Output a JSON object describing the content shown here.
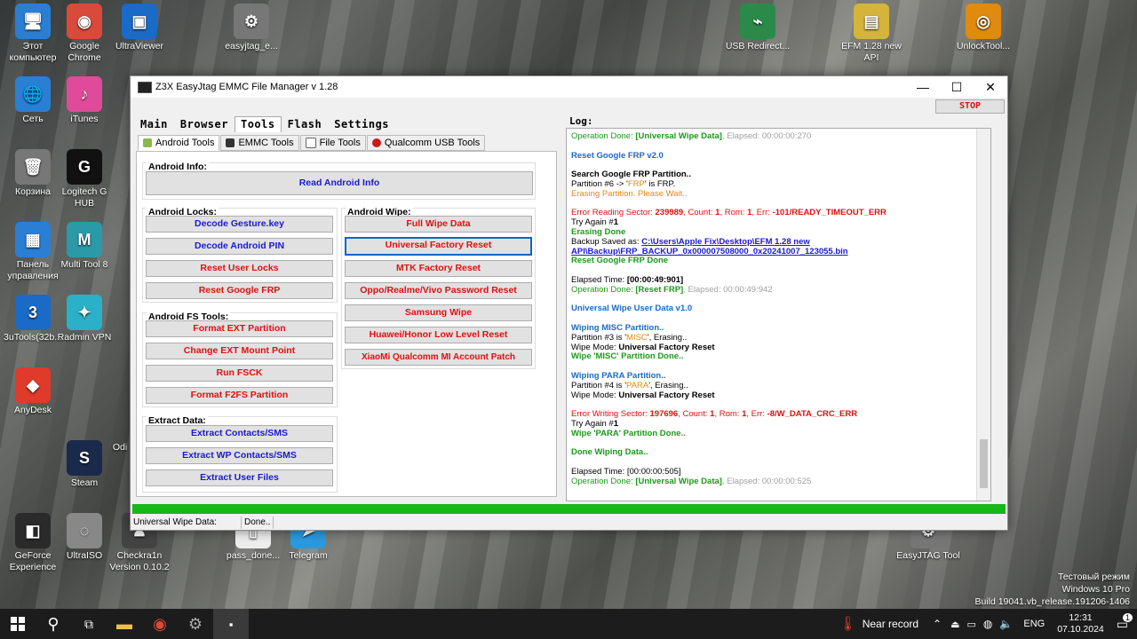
{
  "desktop": {
    "icons": [
      {
        "label": "Этот компьютер",
        "glyph": "🖥",
        "color": "#2a7fd4"
      },
      {
        "label": "Google Chrome",
        "glyph": "◉",
        "color": "#d94a3a"
      },
      {
        "label": "UltraViewer",
        "glyph": "▣",
        "color": "#1a6ac8"
      },
      {
        "label": "easyjtag_e...",
        "glyph": "⚙",
        "color": "#777"
      },
      {
        "label": "USB Redirect...",
        "glyph": "⌁",
        "color": "#2a8a4a"
      },
      {
        "label": "EFM 1.28 new API",
        "glyph": "▤",
        "color": "#d4b43a"
      },
      {
        "label": "UnlockTool...",
        "glyph": "◎",
        "color": "#e08a10"
      },
      {
        "label": "Сеть",
        "glyph": "🌐",
        "color": "#2a7fd4"
      },
      {
        "label": "iTunes",
        "glyph": "♪",
        "color": "#e04a9a"
      },
      {
        "label": "Корзина",
        "glyph": "🗑",
        "color": "#777"
      },
      {
        "label": "Logitech G HUB",
        "glyph": "G",
        "color": "#111"
      },
      {
        "label": "Панель управления",
        "glyph": "▦",
        "color": "#2a7fd4"
      },
      {
        "label": "Multi Tool 8",
        "glyph": "M",
        "color": "#2a9aa8"
      },
      {
        "label": "3uTools(32b...",
        "glyph": "3",
        "color": "#1a6ac8"
      },
      {
        "label": "Radmin VPN",
        "glyph": "✦",
        "color": "#2ab0c8"
      },
      {
        "label": "AnyDesk",
        "glyph": "◆",
        "color": "#e03a2a"
      },
      {
        "label": "Odi",
        "glyph": "",
        "color": "transparent"
      },
      {
        "label": "Steam",
        "glyph": "S",
        "color": "#1a2a4a"
      },
      {
        "label": "GeForce Experience",
        "glyph": "◧",
        "color": "#2a2a2a"
      },
      {
        "label": "UltraISO",
        "glyph": "◌",
        "color": "#888"
      },
      {
        "label": "Checkra1n Version 0.10.2",
        "glyph": "♟",
        "color": "#444"
      },
      {
        "label": "pass_done...",
        "glyph": "▯",
        "color": "#eee"
      },
      {
        "label": "Telegram",
        "glyph": "➤",
        "color": "#2a9ae0"
      },
      {
        "label": "EasyJTAG Tool",
        "glyph": "⚙",
        "color": "#777"
      }
    ]
  },
  "window": {
    "title": "Z3X EasyJtag EMMC File Manager v 1.28",
    "min": "—",
    "max": "☐",
    "close": "✕",
    "stop": "STOP",
    "main_tabs": [
      "Main",
      "Browser",
      "Tools",
      "Flash",
      "Settings"
    ],
    "sub_tabs": [
      "Android Tools",
      "EMMC Tools",
      "File Tools",
      "Qualcomm USB Tools"
    ],
    "android_info": {
      "label": "Android Info:",
      "btn": "Read Android Info"
    },
    "android_locks": {
      "label": "Android Locks:",
      "btns": [
        "Decode Gesture.key",
        "Decode Android PIN",
        "Reset User Locks",
        "Reset Google FRP"
      ]
    },
    "android_wipe": {
      "label": "Android Wipe:",
      "btns": [
        "Full Wipe Data",
        "Universal Factory Reset",
        "MTK Factory Reset",
        "Oppo/Realme/Vivo Password Reset",
        "Samsung Wipe",
        "Huawei/Honor Low Level Reset",
        "XiaoMi Qualcomm MI Account Patch"
      ]
    },
    "android_fs": {
      "label": "Android FS Tools:",
      "btns": [
        "Format EXT Partition",
        "Change EXT Mount Point",
        "Run FSCK",
        "Format F2FS Partition"
      ]
    },
    "extract": {
      "label": "Extract Data:",
      "btns": [
        "Extract Contacts/SMS",
        "Extract WP Contacts/SMS",
        "Extract User Files"
      ]
    },
    "log_label": "Log:",
    "status": {
      "left": "Universal Wipe Data:",
      "right": "Done.."
    }
  },
  "log": {
    "l1a": "Operation Done: ",
    "l1b": "[Universal Wipe Data]",
    "l1c": ", Elapsed: 00:00:00:270",
    "l2": "Reset Google FRP v2.0",
    "l3": "Search Google FRP Partition..",
    "l4a": "Partition #6 -> '",
    "l4b": "FRP",
    "l4c": "' is FRP.",
    "l5": "Erasing Partition. Please Wait..",
    "l6a": "Error Reading Sector: ",
    "l6b": "239989",
    "l6c": ", Count: ",
    "l6d": "1",
    "l6e": ", Rom: ",
    "l6f": "1",
    "l6g": ", Err: ",
    "l6h": "-101/READY_TIMEOUT_ERR",
    "l7a": "Try Again #",
    "l7b": "1",
    "l8": "Erasing Done",
    "l9a": "Backup Saved as: ",
    "l9b": "C:\\Users\\Apple Fix\\Desktop\\EFM 1.28 new",
    "l10": "API\\Backup\\FRP_BACKUP_0x000007508000_0x20241007_123055.bin",
    "l11": "Reset Google FRP Done",
    "l12a": "Elapsed Time: ",
    "l12b": "[00:00:49:901]",
    "l13a": "Operation Done: ",
    "l13b": "[Reset FRP]",
    "l13c": ", Elapsed: 00:00:49:942",
    "l14": "Universal Wipe User Data v1.0",
    "l15": "Wiping MISC Partition..",
    "l16a": "Partition #3 is '",
    "l16b": "MISC",
    "l16c": "', Erasing..",
    "l17a": "Wipe Mode: ",
    "l17b": "Universal Factory Reset",
    "l18": "Wipe 'MISC' Partition Done..",
    "l19": "Wiping PARA Partition..",
    "l20a": "Partition #4 is '",
    "l20b": "PARA",
    "l20c": "', Erasing..",
    "l21a": "Wipe Mode: ",
    "l21b": "Universal Factory Reset",
    "l22a": "Error Writing Sector: ",
    "l22b": "197696",
    "l22c": ", Count: ",
    "l22d": "1",
    "l22e": ", Rom: ",
    "l22f": "1",
    "l22g": ", Err: ",
    "l22h": "-8/W_DATA_CRC_ERR",
    "l23a": "Try Again #",
    "l23b": "1",
    "l24": "Wipe 'PARA' Partition Done..",
    "l25": "Done Wiping Data..",
    "l26a": "Elapsed Time: ",
    "l26b": "[00:00:00:505]",
    "l27a": "Operation Done: ",
    "l27b": "[Universal Wipe Data]",
    "l27c": ", Elapsed: 00:00:00:525"
  },
  "progress": 1.0,
  "watermark": {
    "l1": "Тестовый режим",
    "l2": "Windows 10 Pro",
    "l3": "Build 19041.vb_release.191206-1406"
  },
  "taskbar": {
    "weather": "Near record",
    "lang": "ENG",
    "time": "12:31",
    "date": "07.10.2024",
    "notif": "1"
  }
}
